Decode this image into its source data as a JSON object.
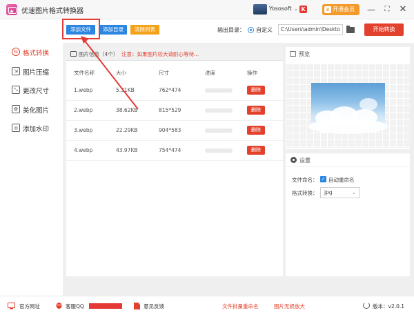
{
  "app": {
    "title": "优速图片格式转换器"
  },
  "user": {
    "name": "Yososoft",
    "dropdown_glyph": "⌄",
    "badge": "K"
  },
  "vip": {
    "label": "开通会员"
  },
  "window_controls": {
    "minimize": "—",
    "maximize": "⛶",
    "close": "✕"
  },
  "sidebar": {
    "items": [
      {
        "label": "格式转换",
        "icon": "⇆"
      },
      {
        "label": "图片压缩",
        "icon": "⇲"
      },
      {
        "label": "更改尺寸",
        "icon": "⤡"
      },
      {
        "label": "美化图片",
        "icon": "✿"
      },
      {
        "label": "添加水印",
        "icon": "◎"
      }
    ]
  },
  "toolbar": {
    "add_file": "添加文件",
    "add_dir": "添加目录",
    "clear_list": "清除列表",
    "output_label": "输出目录：",
    "radio_label": "自定义",
    "output_path": "C:\\Users\\admin\\Deskto",
    "start": "开始转换"
  },
  "file_list": {
    "header_title": "图片信息（4个）",
    "header_note": "注意：如果图片较大请耐心等待...",
    "columns": [
      "文件名称",
      "大小",
      "尺寸",
      "进度",
      "操作"
    ],
    "rows": [
      {
        "name": "1.webp",
        "size": "5.31KB",
        "dims": "762*474",
        "progress": 0,
        "action": "删除"
      },
      {
        "name": "2.webp",
        "size": "38.62KB",
        "dims": "815*529",
        "progress": 0,
        "action": "删除"
      },
      {
        "name": "3.webp",
        "size": "22.29KB",
        "dims": "904*583",
        "progress": 0,
        "action": "删除"
      },
      {
        "name": "4.webp",
        "size": "43.97KB",
        "dims": "754*474",
        "progress": 0,
        "action": "删除"
      }
    ]
  },
  "preview": {
    "title": "预览"
  },
  "settings": {
    "title": "设置",
    "rename_label": "文件命名：",
    "auto_rename": "自动重命名",
    "auto_rename_checked": true,
    "format_label": "格式转换：",
    "format_value": "jpg"
  },
  "bottom": {
    "website": "官方网址",
    "qq": "客服QQ",
    "feedback": "意见反馈",
    "batch_rename": "文件批量重命名",
    "lossless": "图片无损放大",
    "version": "版本：v2.0.1"
  },
  "colors": {
    "accent_red": "#e2412d",
    "blue": "#2c86e0",
    "orange": "#f4a21a"
  }
}
